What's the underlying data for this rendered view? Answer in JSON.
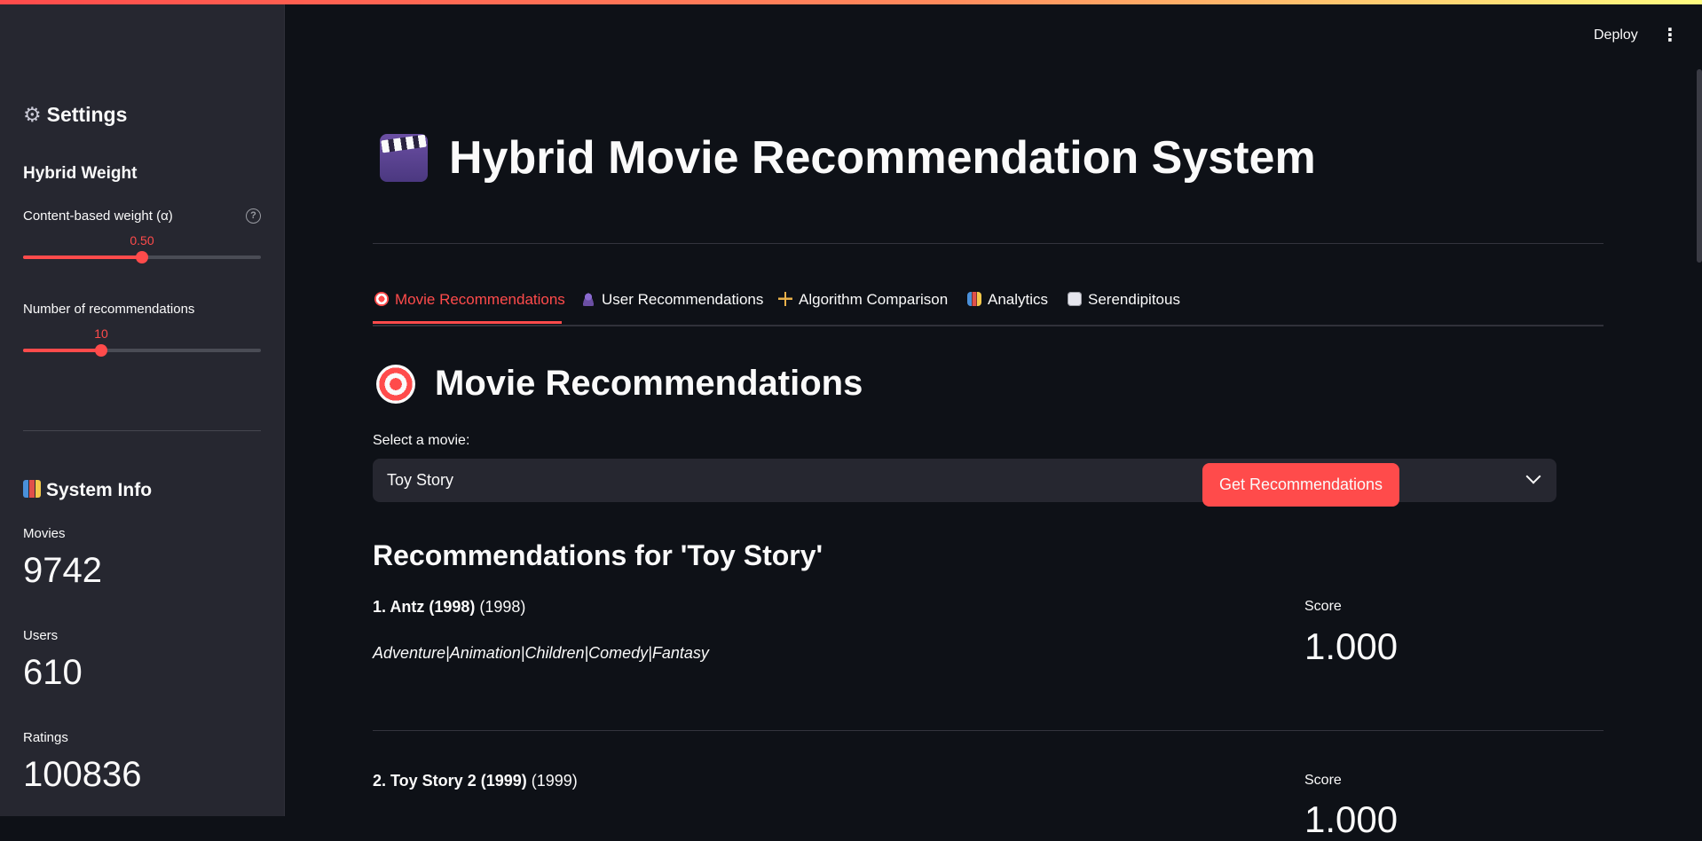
{
  "sidebar": {
    "settings_title": "Settings",
    "hybrid_title": "Hybrid Weight",
    "alpha_label": "Content-based weight (α)",
    "alpha_value": "0.50",
    "alpha_fraction": 0.5,
    "num_label": "Number of recommendations",
    "num_value": "10",
    "num_fraction": 0.33,
    "sysinfo_title": "System Info",
    "metrics": [
      {
        "label": "Movies",
        "value": "9742"
      },
      {
        "label": "Users",
        "value": "610"
      },
      {
        "label": "Ratings",
        "value": "100836"
      }
    ]
  },
  "header": {
    "deploy_label": "Deploy"
  },
  "main": {
    "title": "Hybrid Movie Recommendation System",
    "tabs": [
      {
        "label": "Movie Recommendations"
      },
      {
        "label": "User Recommendations"
      },
      {
        "label": "Algorithm Comparison"
      },
      {
        "label": "Analytics"
      },
      {
        "label": "Serendipitous"
      }
    ],
    "section_title": "Movie Recommendations",
    "select_label": "Select a movie:",
    "select_value": "Toy Story",
    "button_label": "Get Recommendations",
    "results_title": "Recommendations for 'Toy Story'",
    "results": [
      {
        "rank_title": "1. Antz (1998)",
        "year": "(1998)",
        "genres": "Adventure|Animation|Children|Comedy|Fantasy",
        "score_label": "Score",
        "score": "1.000"
      },
      {
        "rank_title": "2. Toy Story 2 (1999)",
        "year": "(1999)",
        "genres": "",
        "score_label": "Score",
        "score": "1.000"
      }
    ]
  },
  "colors": {
    "accent": "#ff4b4b",
    "background": "#0e1117",
    "sidebar": "#262730"
  }
}
